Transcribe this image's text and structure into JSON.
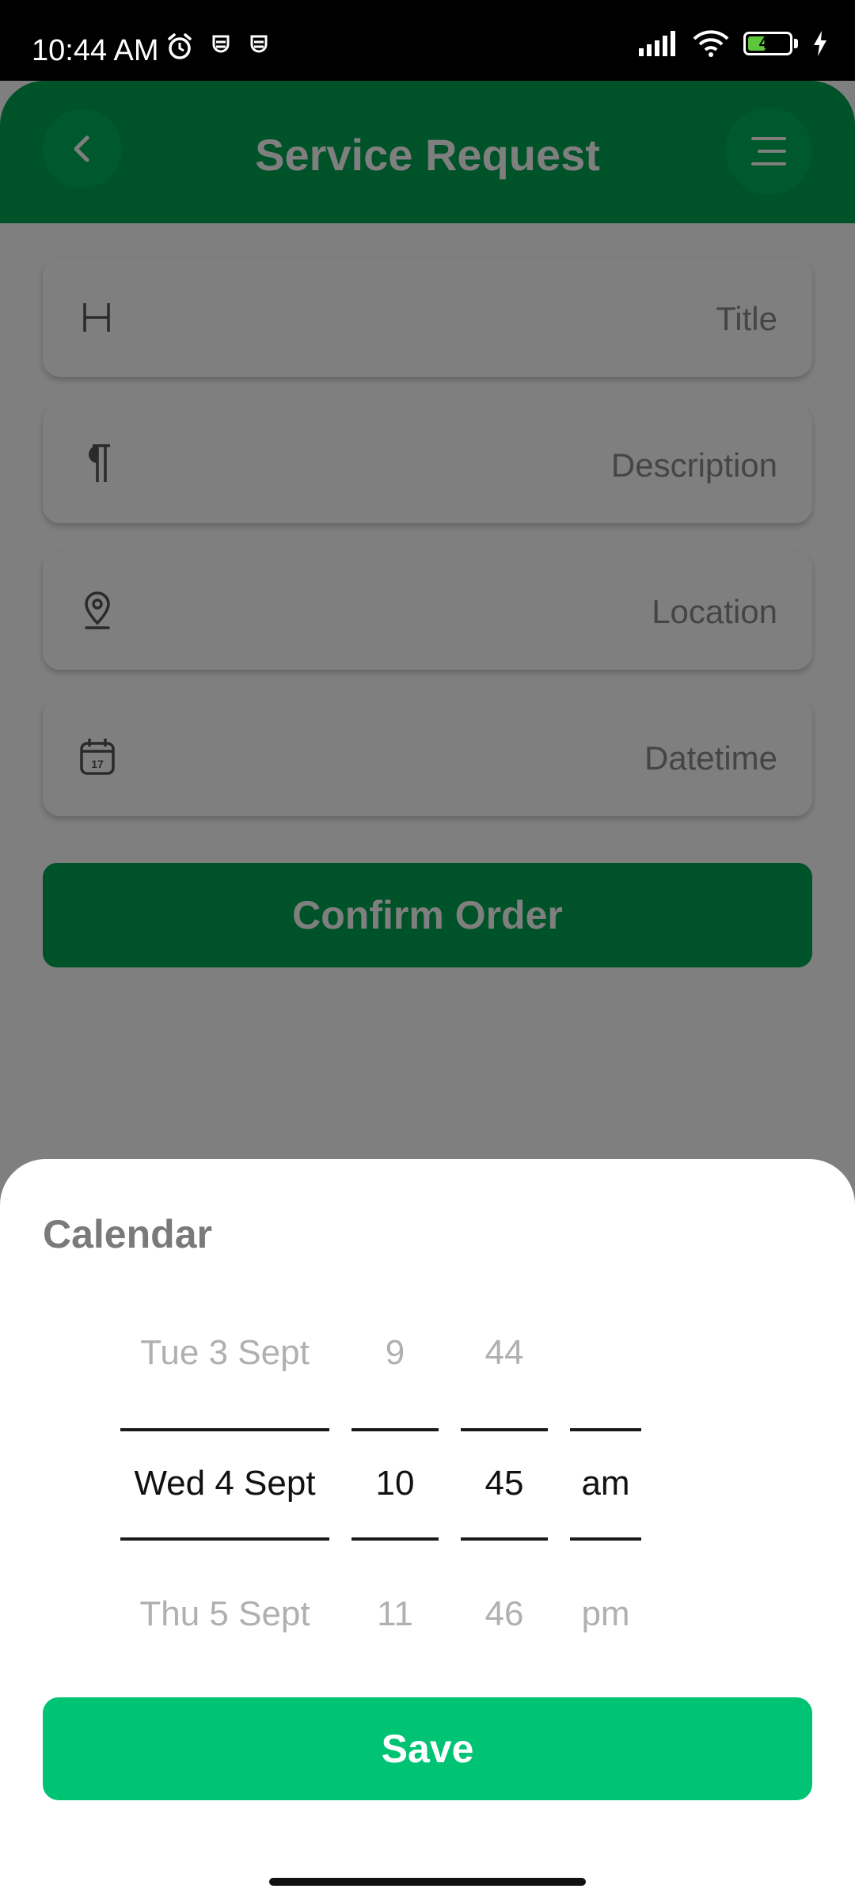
{
  "status_bar": {
    "time": "10:44 AM",
    "battery_level": "40"
  },
  "header": {
    "title": "Service Request"
  },
  "form": {
    "title_field": "Title",
    "description_field": "Description",
    "location_field": "Location",
    "datetime_field": "Datetime",
    "confirm_label": "Confirm Order"
  },
  "calendar": {
    "title": "Calendar",
    "day": {
      "prev": "Tue 3 Sept",
      "selected": "Wed 4 Sept",
      "next": "Thu 5 Sept"
    },
    "hour": {
      "prev": "9",
      "selected": "10",
      "next": "11"
    },
    "minute": {
      "prev": "44",
      "selected": "45",
      "next": "46"
    },
    "period": {
      "prev": "",
      "selected": "am",
      "next": "pm"
    },
    "save_label": "Save"
  },
  "colors": {
    "header": "#00a550",
    "save": "#00c473",
    "battery": "#5ec63b"
  },
  "icons": {
    "back": "chevron-left-icon",
    "menu": "menu-icon",
    "title": "heading-icon",
    "description": "paragraph-icon",
    "location": "location-pin-icon",
    "datetime": "calendar-icon"
  }
}
